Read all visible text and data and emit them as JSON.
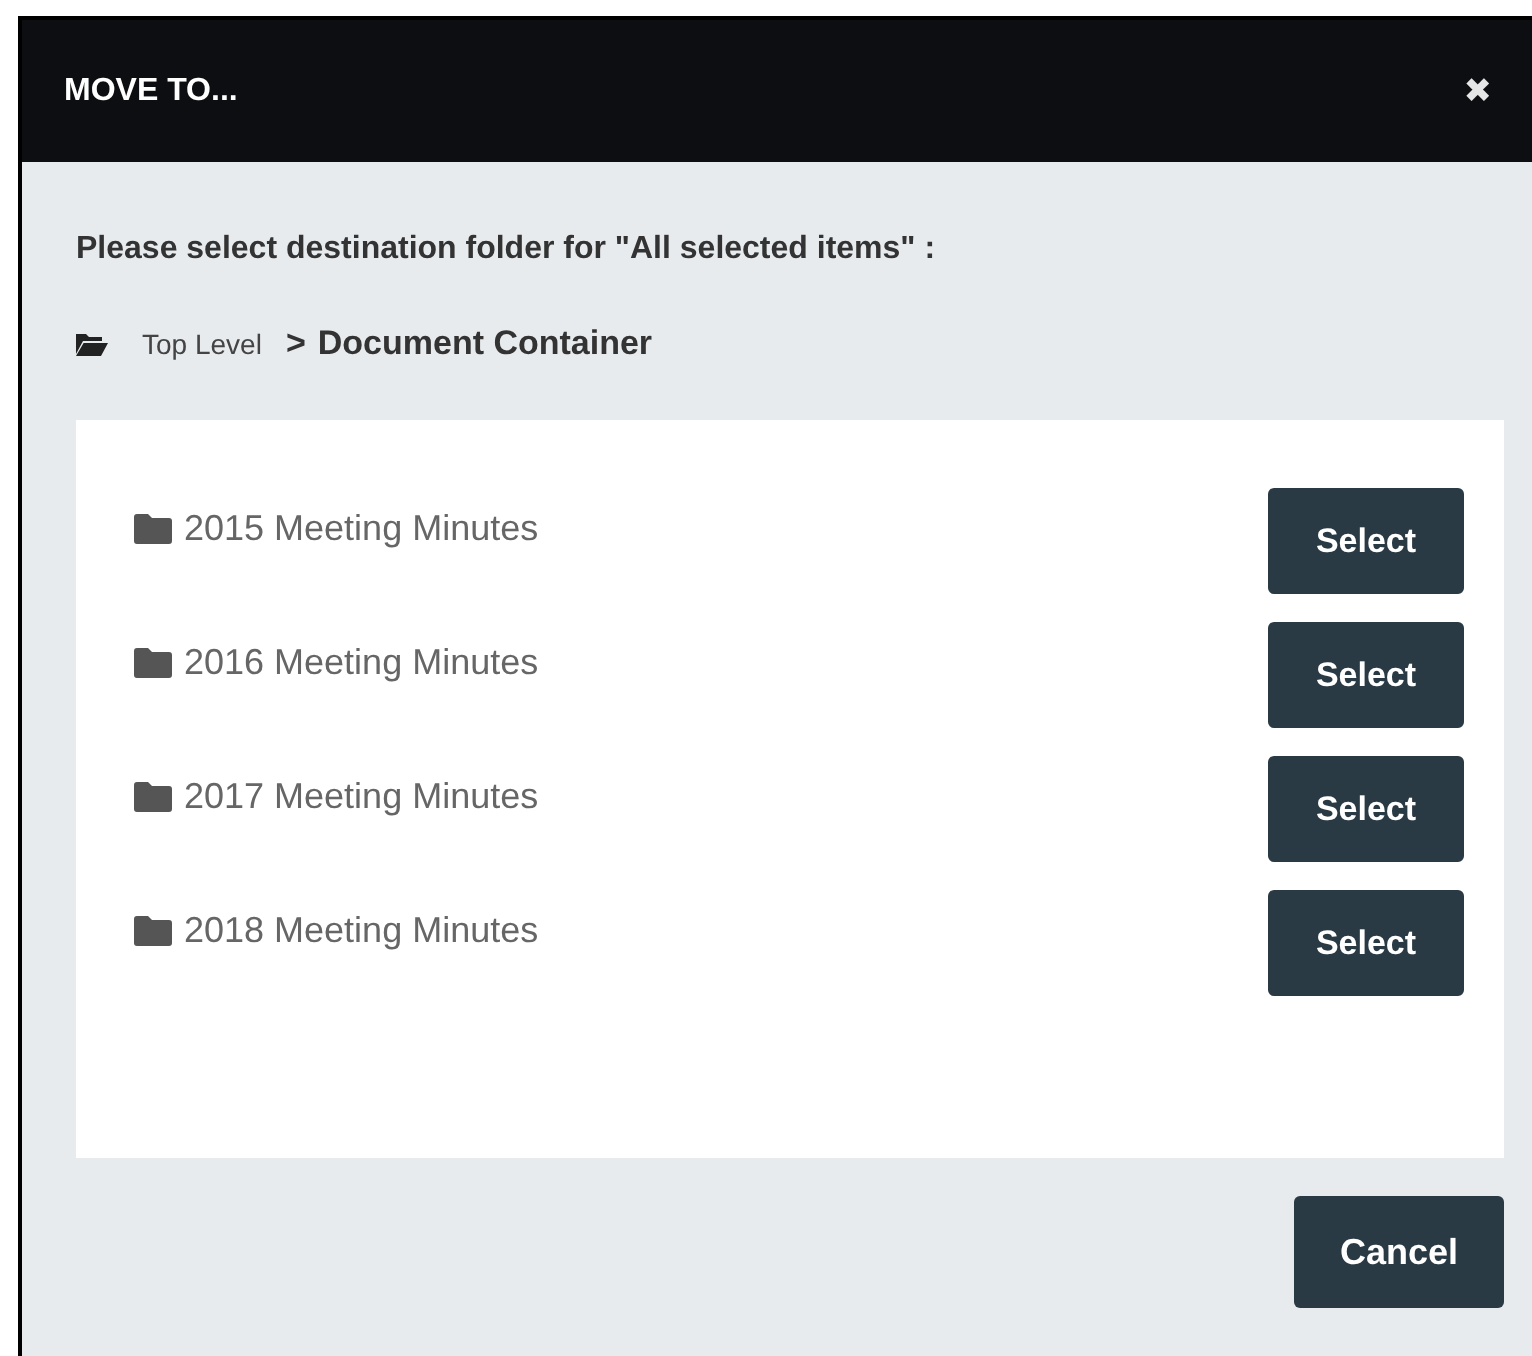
{
  "dialog": {
    "title": "MOVE TO...",
    "close": "✖"
  },
  "prompt": "Please select destination folder for \"All selected items\" :",
  "breadcrumb": {
    "root": "Top Level",
    "separator": ">",
    "current": "Document Container"
  },
  "folders": [
    {
      "name": "2015 Meeting Minutes",
      "action": "Select"
    },
    {
      "name": "2016 Meeting Minutes",
      "action": "Select"
    },
    {
      "name": "2017 Meeting Minutes",
      "action": "Select"
    },
    {
      "name": "2018 Meeting Minutes",
      "action": "Select"
    }
  ],
  "buttons": [
    "Cancel"
  ]
}
